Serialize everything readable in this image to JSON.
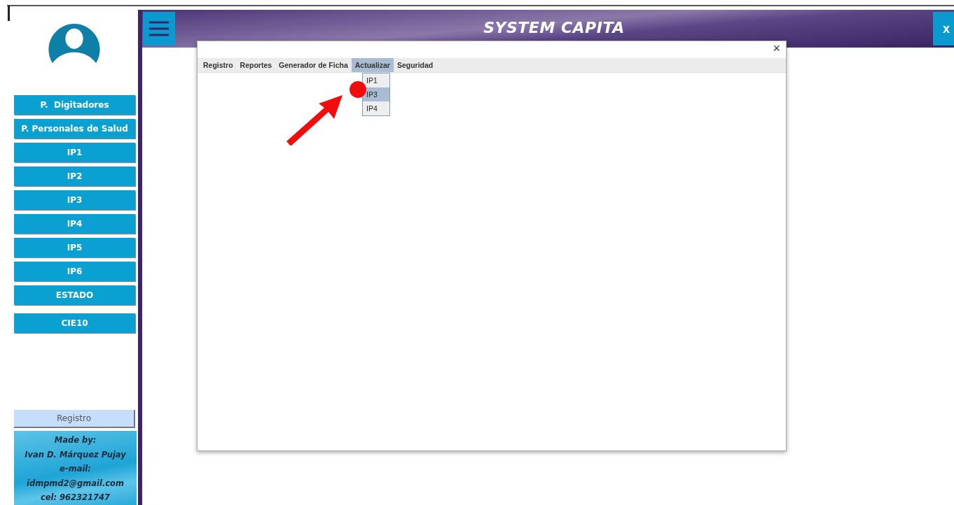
{
  "sidebar": {
    "items": [
      {
        "label": "P.  Digitadores"
      },
      {
        "label": "P. Personales de Salud"
      },
      {
        "label": "IP1"
      },
      {
        "label": "IP2"
      },
      {
        "label": "IP3"
      },
      {
        "label": "IP4"
      },
      {
        "label": "IP5"
      },
      {
        "label": "IP6"
      },
      {
        "label": "ESTADO"
      },
      {
        "label": "CIE10"
      }
    ],
    "register_button": "Registro",
    "credits": [
      "Made by:",
      "Ivan D. Márquez Pujay",
      "e-mail:",
      "idmpmd2@gmail.com",
      "cel: 962321747"
    ]
  },
  "header": {
    "title": "SYSTEM CAPITA",
    "close_label": "x"
  },
  "dialog": {
    "close_label": "×",
    "menu": [
      {
        "label": "Registro",
        "selected": false
      },
      {
        "label": "Reportes",
        "selected": false
      },
      {
        "label": "Generador de Ficha",
        "selected": false
      },
      {
        "label": "Actualizar",
        "selected": true
      },
      {
        "label": "Seguridad",
        "selected": false
      }
    ],
    "dropdown": [
      {
        "label": "IP1",
        "selected": false
      },
      {
        "label": "IP3",
        "selected": true
      },
      {
        "label": "IP4",
        "selected": false
      }
    ]
  }
}
